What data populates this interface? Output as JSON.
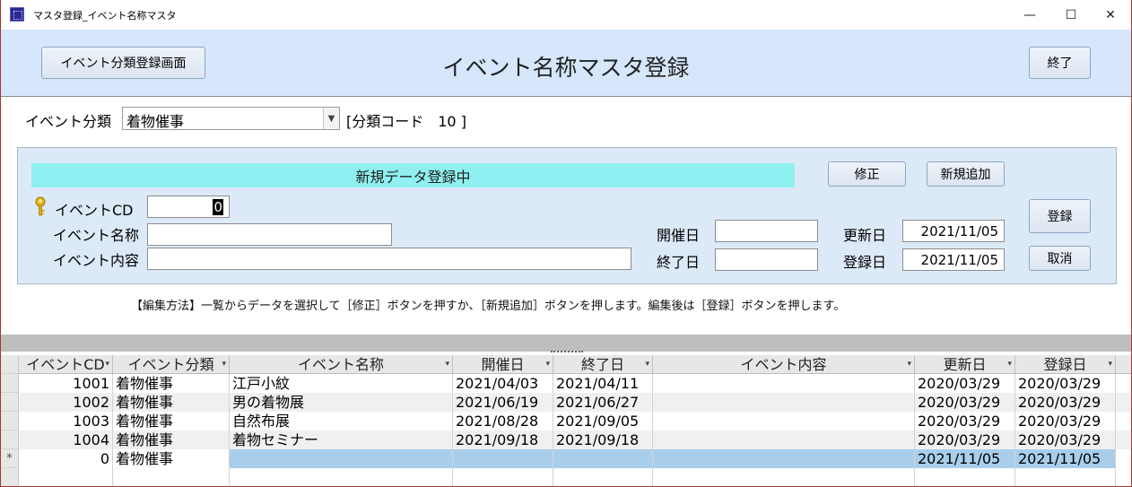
{
  "window": {
    "title": "マスタ登録_イベント名称マスタ",
    "minimize": "—",
    "maximize": "☐",
    "close": "✕"
  },
  "header": {
    "category_screen_button": "イベント分類登録画面",
    "form_title": "イベント名称マスタ登録",
    "exit_button": "終了"
  },
  "filter": {
    "category_label": "イベント分類",
    "category_value": "着物催事",
    "category_code_text": "[分類コード　10 ]"
  },
  "edit_panel": {
    "mode_text": "新規データ登録中",
    "modify_button": "修正",
    "new_button": "新規追加",
    "register_button": "登録",
    "cancel_button": "取消",
    "event_cd_label": "イベントCD",
    "event_cd_value": "0",
    "event_name_label": "イベント名称",
    "event_name_value": "",
    "event_content_label": "イベント内容",
    "event_content_value": "",
    "start_date_label": "開催日",
    "start_date_value": "",
    "end_date_label": "終了日",
    "end_date_value": "",
    "updated_label": "更新日",
    "updated_value": "2021/11/05",
    "registered_label": "登録日",
    "registered_value": "2021/11/05"
  },
  "hint": "【編集方法】一覧からデータを選択して［修正］ボタンを押すか、［新規追加］ボタンを押します。編集後は［登録］ボタンを押します。",
  "grid": {
    "columns": [
      "イベントCD",
      "イベント分類",
      "イベント名称",
      "開催日",
      "終了日",
      "イベント内容",
      "更新日",
      "登録日"
    ],
    "sort_icon": "▾",
    "new_row_marker": "*",
    "rows": [
      [
        "1001",
        "着物催事",
        "江戸小紋",
        "2021/04/03",
        "2021/04/11",
        "",
        "2020/03/29",
        "2020/03/29"
      ],
      [
        "1002",
        "着物催事",
        "男の着物展",
        "2021/06/19",
        "2021/06/27",
        "",
        "2020/03/29",
        "2020/03/29"
      ],
      [
        "1003",
        "着物催事",
        "自然布展",
        "2021/08/28",
        "2021/09/05",
        "",
        "2020/03/29",
        "2020/03/29"
      ],
      [
        "1004",
        "着物催事",
        "着物セミナー",
        "2021/09/18",
        "2021/09/18",
        "",
        "2020/03/29",
        "2020/03/29"
      ],
      [
        "0",
        "着物催事",
        "",
        "",
        "",
        "",
        "2021/11/05",
        "2021/11/05"
      ]
    ]
  },
  "colors": {
    "header_band": "#d6e6fb",
    "panel": "#dce9f7",
    "mode_bar": "#8ef0f0",
    "selected_row": "#a8ceeb",
    "window_border": "#aa3333"
  }
}
